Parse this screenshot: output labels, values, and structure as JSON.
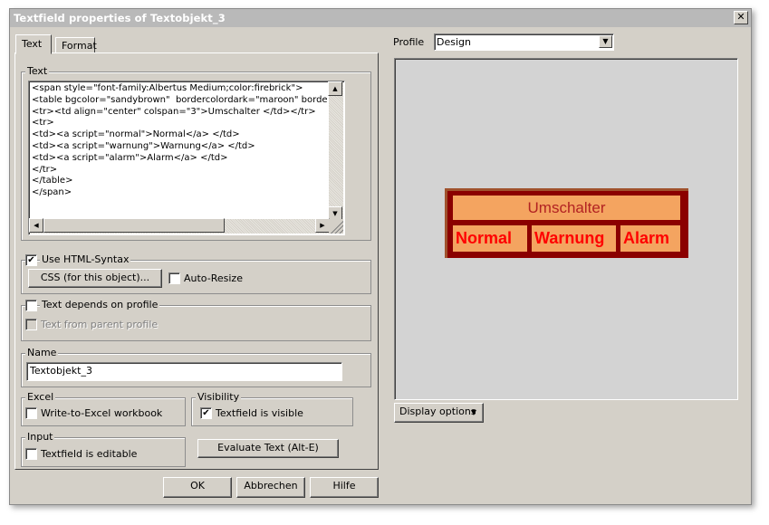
{
  "window": {
    "title": "Textfield properties of Textobjekt_3",
    "close_glyph": "✕"
  },
  "tabs": [
    {
      "label": "Text",
      "active": true
    },
    {
      "label": "Format",
      "active": false
    }
  ],
  "text_group": {
    "label": "Text",
    "lines": [
      "<span style=\"font-family:Albertus Medium;color:firebrick\">",
      "<table bgcolor=\"sandybrown\"  bordercolordark=\"maroon\" bordercolorlight=\"sienna\">",
      "<tr><td align=\"center\" colspan=\"3\">Umschalter </td></tr>",
      "<tr>",
      "<td><a script=\"normal\">Normal</a> </td>",
      "<td><a script=\"warnung\">Warnung</a> </td>",
      "<td><a script=\"alarm\">Alarm</a> </td>",
      "</tr>",
      "</table>",
      "</span>"
    ]
  },
  "html_group": {
    "label": "Use HTML-Syntax",
    "checked": true,
    "css_button": "CSS (for this object)...",
    "auto_resize_label": "Auto-Resize",
    "auto_resize_checked": false
  },
  "profile_group": {
    "label": "Text depends on profile",
    "checked": false,
    "parent_label": "Text from parent profile",
    "parent_checked": false
  },
  "name_group": {
    "label": "Name",
    "value": "Textobjekt_3"
  },
  "excel_group": {
    "label": "Excel",
    "checkbox_label": "Write-to-Excel workbook",
    "checked": false
  },
  "visibility_group": {
    "label": "Visibility",
    "checkbox_label": "Textfield is visible",
    "checked": true
  },
  "input_group": {
    "label": "Input",
    "checkbox_label": "Textfield is editable",
    "checked": false
  },
  "evaluate_button": "Evaluate Text (Alt-E)",
  "dialog_buttons": {
    "ok": "OK",
    "cancel": "Abbrechen",
    "help": "Hilfe"
  },
  "profile": {
    "label": "Profile",
    "value": "Design"
  },
  "preview": {
    "header": "Umschalter",
    "cells": [
      "Normal",
      "Warnung",
      "Alarm"
    ],
    "colors": {
      "text": "#b22222",
      "bold_text": "#ff0000",
      "cell_bg": "#f4a460",
      "border_dark": "#8b0000",
      "border_light": "#a0522d"
    }
  },
  "display_options_button": "Display options",
  "check_glyph": "✔"
}
